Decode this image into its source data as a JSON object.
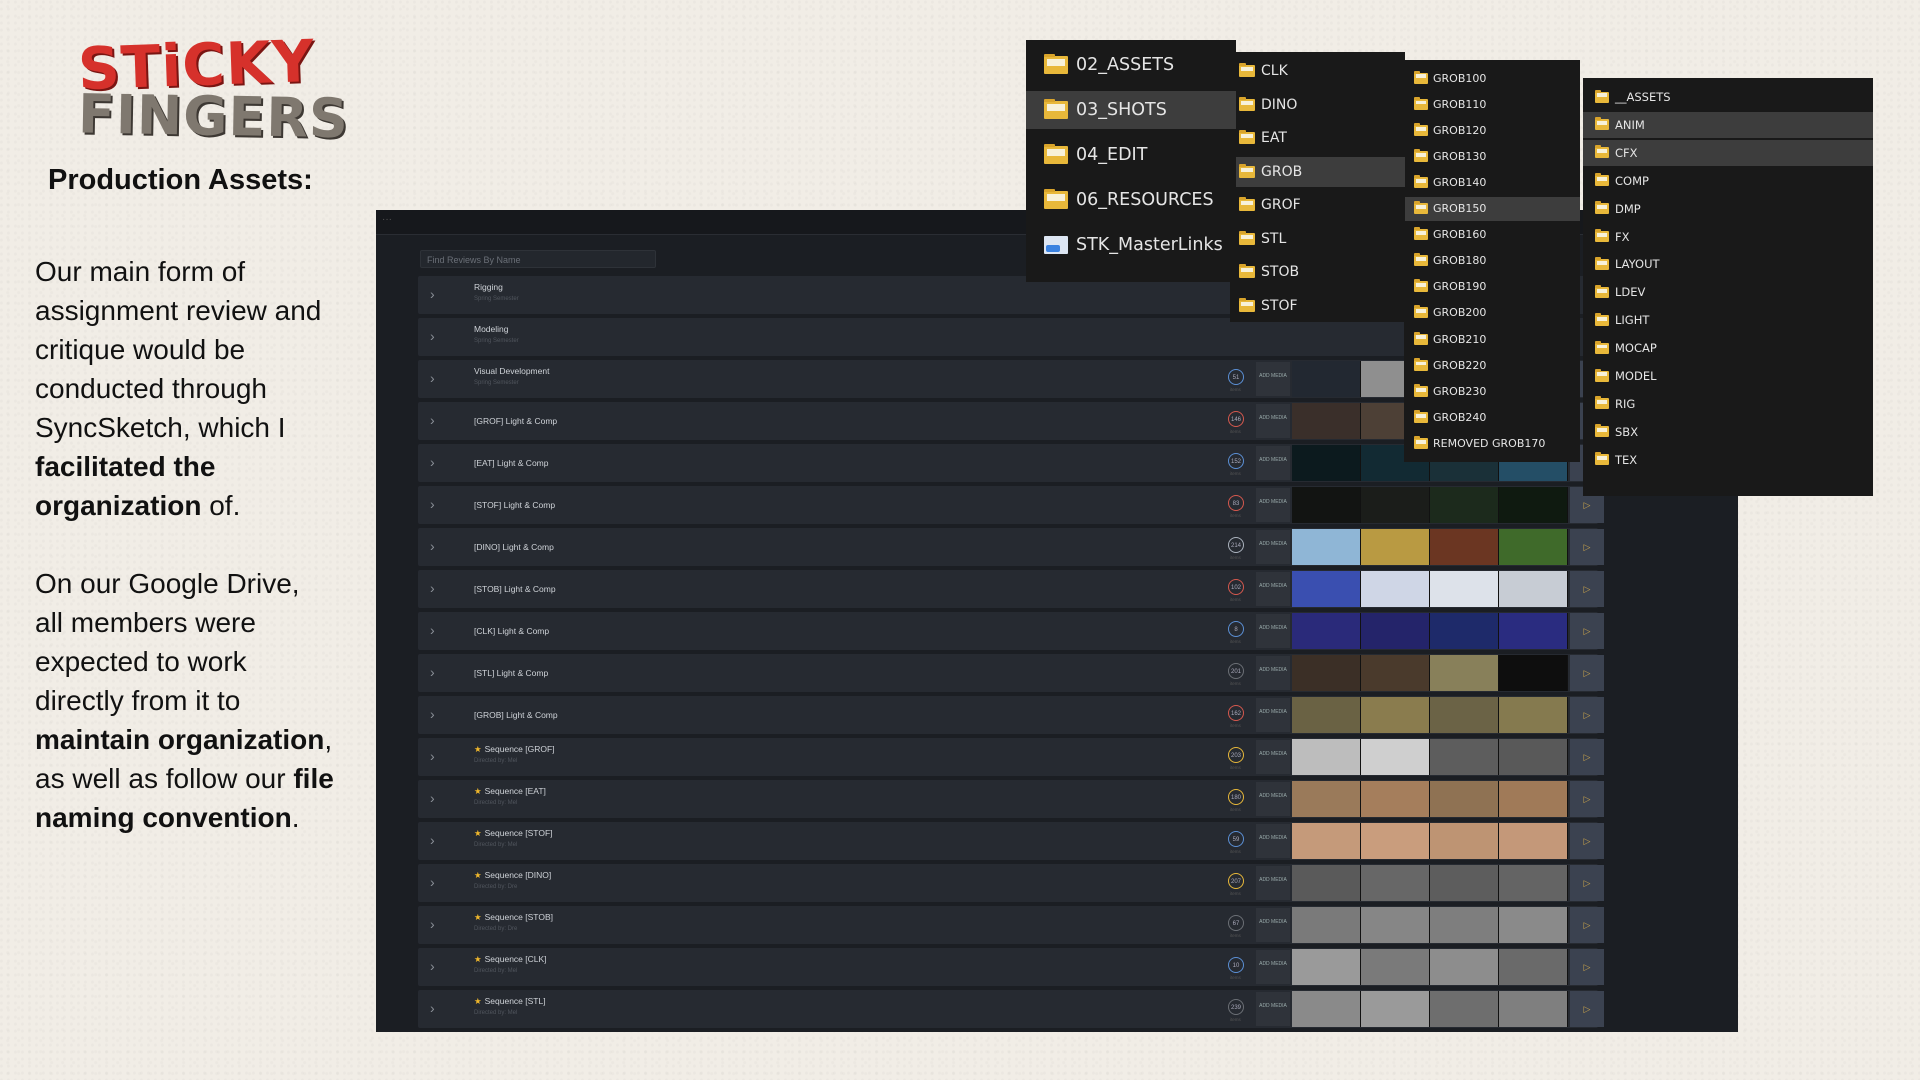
{
  "slide": {
    "logo_line1": "STiCKY",
    "logo_line2": "FINGERS",
    "heading": "Production Assets:",
    "p1": {
      "text_a": "Our main form of assignment review and critique would be conducted through SyncSketch, which I ",
      "bold_a": "facilitated the organization",
      "text_b": " of."
    },
    "p2": {
      "text_a": "On our Google Drive, all members were expected to work directly from it to ",
      "bold_a": "maintain organization",
      "text_b": ", as well as follow our ",
      "bold_b": "file naming convention",
      "text_c": "."
    }
  },
  "syncsketch": {
    "search_placeholder": "Find Reviews By Name",
    "add_media_label": "ADD MEDIA",
    "items_label": "items",
    "rows": [
      {
        "title": "Rigging",
        "subtitle": "Spring Semester",
        "count": "",
        "starred": false,
        "thumbs": []
      },
      {
        "title": "Modeling",
        "subtitle": "Spring Semester",
        "count": "",
        "starred": false,
        "thumbs": []
      },
      {
        "title": "Visual Development",
        "subtitle": "Spring Semester",
        "count": "51",
        "ring": "#5b8fd4",
        "starred": false,
        "thumbs": [
          "#222831",
          "#8f8f8f",
          "#2b2a28",
          "#b8b6ac"
        ]
      },
      {
        "title": "[GROF] Light & Comp",
        "subtitle": "",
        "count": "146",
        "ring": "#d4584e",
        "starred": false,
        "thumbs": [
          "#3a2f2a",
          "#4d4036",
          "#2a2a2a",
          "#7a7455"
        ]
      },
      {
        "title": "[EAT] Light & Comp",
        "subtitle": "",
        "count": "152",
        "ring": "#5b8fd4",
        "starred": false,
        "thumbs": [
          "#0c1a1e",
          "#122a33",
          "#1a3038",
          "#244e66"
        ]
      },
      {
        "title": "[STOF] Light & Comp",
        "subtitle": "",
        "count": "83",
        "ring": "#d4584e",
        "starred": false,
        "thumbs": [
          "#121412",
          "#1b1d1a",
          "#1c2a1c",
          "#0f1a10"
        ]
      },
      {
        "title": "[DINO] Light & Comp",
        "subtitle": "",
        "count": "214",
        "ring": "#aab2bd",
        "starred": false,
        "thumbs": [
          "#8fb6d6",
          "#b99a42",
          "#6b3622",
          "#3f6a2a"
        ]
      },
      {
        "title": "[STOB] Light & Comp",
        "subtitle": "",
        "count": "102",
        "ring": "#d4584e",
        "starred": false,
        "thumbs": [
          "#3a4fb0",
          "#cfd6e6",
          "#dde2ea",
          "#c7ccd4"
        ]
      },
      {
        "title": "[CLK] Light & Comp",
        "subtitle": "",
        "count": "8",
        "ring": "#5b8fd4",
        "starred": false,
        "thumbs": [
          "#2a2a7a",
          "#24246a",
          "#1e2a6a",
          "#2a2c80"
        ]
      },
      {
        "title": "[STL] Light & Comp",
        "subtitle": "",
        "count": "201",
        "ring": "#6b6f75",
        "starred": false,
        "thumbs": [
          "#3b2f26",
          "#4a3a2c",
          "#88805a",
          "#0e0e0e"
        ]
      },
      {
        "title": "[GROB] Light & Comp",
        "subtitle": "",
        "count": "162",
        "ring": "#d4584e",
        "starred": false,
        "thumbs": [
          "#6a6244",
          "#8a7c4e",
          "#6b6346",
          "#857a4f"
        ]
      },
      {
        "title": "Sequence [GROF]",
        "subtitle": "Directed by: Mel",
        "count": "203",
        "ring": "#e6b73a",
        "starred": true,
        "thumbs": [
          "#bdbdbd",
          "#cfcfcf",
          "#5d5d5d",
          "#595959"
        ]
      },
      {
        "title": "Sequence [EAT]",
        "subtitle": "Directed by: Mel",
        "count": "180",
        "ring": "#e6b73a",
        "starred": true,
        "thumbs": [
          "#9a7a5a",
          "#a57e5c",
          "#8f7253",
          "#a07a58"
        ]
      },
      {
        "title": "Sequence [STOF]",
        "subtitle": "Directed by: Mel",
        "count": "59",
        "ring": "#5b8fd4",
        "starred": true,
        "thumbs": [
          "#c59a7a",
          "#c99d7d",
          "#be9473",
          "#c49879"
        ]
      },
      {
        "title": "Sequence [DINO]",
        "subtitle": "Directed by: Dre",
        "count": "207",
        "ring": "#e6b73a",
        "starred": true,
        "thumbs": [
          "#5a5a5a",
          "#676767",
          "#5d5d5d",
          "#646464"
        ]
      },
      {
        "title": "Sequence [STOB]",
        "subtitle": "Directed by: Dre",
        "count": "67",
        "ring": "#6b6f75",
        "starred": true,
        "thumbs": [
          "#7a7a7a",
          "#868686",
          "#7e7e7e",
          "#8a8a8a"
        ]
      },
      {
        "title": "Sequence [CLK]",
        "subtitle": "Directed by: Mel",
        "count": "10",
        "ring": "#5b8fd4",
        "starred": true,
        "thumbs": [
          "#9a9a9a",
          "#7a7a7a",
          "#8d8d8d",
          "#6a6a6a"
        ]
      },
      {
        "title": "Sequence [STL]",
        "subtitle": "Directed by: Mel",
        "count": "239",
        "ring": "#6b6f75",
        "starred": true,
        "thumbs": [
          "#8a8a8a",
          "#9a9a9a",
          "#6e6e6e",
          "#7f7f7f"
        ]
      }
    ]
  },
  "explorer": {
    "root": [
      {
        "label": "02_ASSETS",
        "icon": "folder",
        "selected": false
      },
      {
        "label": "03_SHOTS",
        "icon": "folder",
        "selected": true
      },
      {
        "label": "04_EDIT",
        "icon": "folder",
        "selected": false
      },
      {
        "label": "06_RESOURCES",
        "icon": "folder",
        "selected": false
      },
      {
        "label": "STK_MasterLinks",
        "icon": "link",
        "selected": false
      }
    ],
    "shots": [
      {
        "label": "CLK",
        "selected": false
      },
      {
        "label": "DINO",
        "selected": false
      },
      {
        "label": "EAT",
        "selected": false
      },
      {
        "label": "GROB",
        "selected": true
      },
      {
        "label": "GROF",
        "selected": false
      },
      {
        "label": "STL",
        "selected": false
      },
      {
        "label": "STOB",
        "selected": false
      },
      {
        "label": "STOF",
        "selected": false
      }
    ],
    "grob": [
      {
        "label": "GROB100",
        "selected": false
      },
      {
        "label": "GROB110",
        "selected": false
      },
      {
        "label": "GROB120",
        "selected": false
      },
      {
        "label": "GROB130",
        "selected": false
      },
      {
        "label": "GROB140",
        "selected": false
      },
      {
        "label": "GROB150",
        "selected": true
      },
      {
        "label": "GROB160",
        "selected": false
      },
      {
        "label": "GROB180",
        "selected": false
      },
      {
        "label": "GROB190",
        "selected": false
      },
      {
        "label": "GROB200",
        "selected": false
      },
      {
        "label": "GROB210",
        "selected": false
      },
      {
        "label": "GROB220",
        "selected": false
      },
      {
        "label": "GROB230",
        "selected": false
      },
      {
        "label": "GROB240",
        "selected": false
      },
      {
        "label": "REMOVED GROB170",
        "selected": false
      }
    ],
    "grob150": [
      {
        "label": "__ASSETS",
        "selected": false
      },
      {
        "label": "ANIM",
        "selected": true
      },
      {
        "label": "CFX",
        "selected": true
      },
      {
        "label": "COMP",
        "selected": false
      },
      {
        "label": "DMP",
        "selected": false
      },
      {
        "label": "FX",
        "selected": false
      },
      {
        "label": "LAYOUT",
        "selected": false
      },
      {
        "label": "LDEV",
        "selected": false
      },
      {
        "label": "LIGHT",
        "selected": false
      },
      {
        "label": "MOCAP",
        "selected": false
      },
      {
        "label": "MODEL",
        "selected": false
      },
      {
        "label": "RIG",
        "selected": false
      },
      {
        "label": "SBX",
        "selected": false
      },
      {
        "label": "TEX",
        "selected": false
      }
    ]
  }
}
